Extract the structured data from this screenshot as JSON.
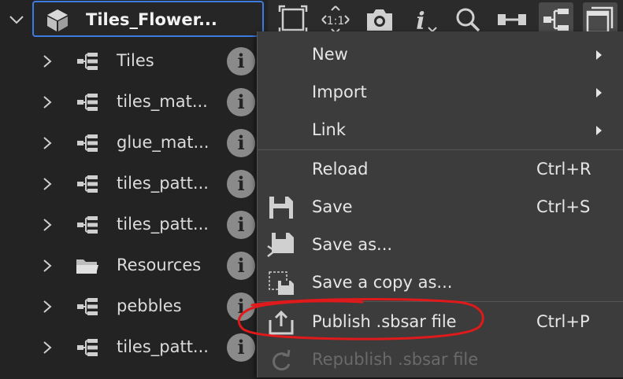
{
  "tree": {
    "root": {
      "label": "Tiles_Flower...",
      "icon": "package-icon"
    },
    "items": [
      {
        "label": "Tiles",
        "icon": "graph-icon"
      },
      {
        "label": "tiles_mat...",
        "icon": "graph-icon"
      },
      {
        "label": "glue_mat...",
        "icon": "graph-icon"
      },
      {
        "label": "tiles_patt...",
        "icon": "graph-icon"
      },
      {
        "label": "tiles_patt...",
        "icon": "graph-icon"
      },
      {
        "label": "Resources",
        "icon": "folder-icon"
      },
      {
        "label": "pebbles",
        "icon": "graph-icon"
      },
      {
        "label": "tiles_patt...",
        "icon": "graph-icon"
      }
    ],
    "info_glyph": "i"
  },
  "toolbar": {
    "zoom_label": "1:1",
    "buttons": [
      "fit-view-icon",
      "zoom-1to1-icon",
      "camera-icon",
      "info-dropdown-icon",
      "search-icon",
      "node-link-icon",
      "graph-view-icon",
      "window-stack-icon"
    ]
  },
  "menu": {
    "new": {
      "label": "New"
    },
    "import": {
      "label": "Import"
    },
    "link": {
      "label": "Link"
    },
    "reload": {
      "label": "Reload",
      "shortcut": "Ctrl+R"
    },
    "save": {
      "label": "Save",
      "shortcut": "Ctrl+S"
    },
    "save_as": {
      "label": "Save as..."
    },
    "save_copy": {
      "label": "Save a copy as..."
    },
    "publish": {
      "label": "Publish .sbsar file",
      "shortcut": "Ctrl+P"
    },
    "republish": {
      "label": "Republish .sbsar file"
    }
  },
  "colors": {
    "selection_border": "#3d7be0",
    "annotation": "#e0191b"
  }
}
